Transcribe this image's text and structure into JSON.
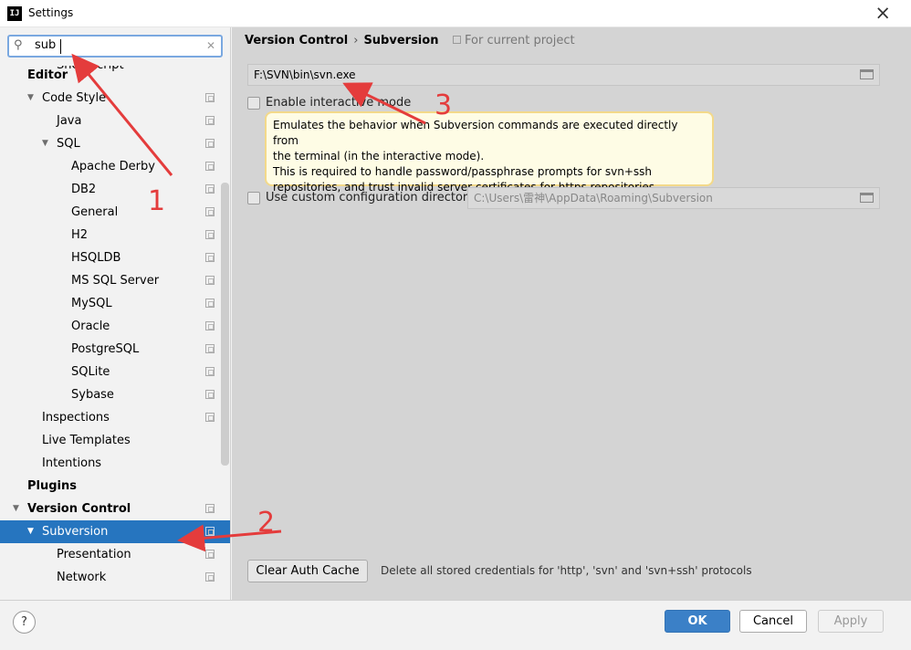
{
  "window": {
    "title": "Settings",
    "app_icon_text": "IJ",
    "close_icon": "close-icon"
  },
  "search": {
    "value": "sub",
    "search_icon": "search-icon",
    "clear_icon": "clear-icon"
  },
  "tree": {
    "items": [
      {
        "label": "Shell Script",
        "kind": "leaf",
        "copy": false
      },
      {
        "label": "Editor",
        "kind": "section",
        "copy": false
      },
      {
        "label": "Code Style",
        "kind": "expanded",
        "copy": true
      },
      {
        "label": "Java",
        "kind": "leaf",
        "copy": true
      },
      {
        "label": "SQL",
        "kind": "expanded",
        "copy": true
      },
      {
        "label": "Apache Derby",
        "kind": "leaf",
        "copy": true
      },
      {
        "label": "DB2",
        "kind": "leaf",
        "copy": true
      },
      {
        "label": "General",
        "kind": "leaf",
        "copy": true
      },
      {
        "label": "H2",
        "kind": "leaf",
        "copy": true
      },
      {
        "label": "HSQLDB",
        "kind": "leaf",
        "copy": true
      },
      {
        "label": "MS SQL Server",
        "kind": "leaf",
        "copy": true
      },
      {
        "label": "MySQL",
        "kind": "leaf",
        "copy": true
      },
      {
        "label": "Oracle",
        "kind": "leaf",
        "copy": true
      },
      {
        "label": "PostgreSQL",
        "kind": "leaf",
        "copy": true
      },
      {
        "label": "SQLite",
        "kind": "leaf",
        "copy": true
      },
      {
        "label": "Sybase",
        "kind": "leaf",
        "copy": true
      },
      {
        "label": "Inspections",
        "kind": "leaf",
        "copy": true
      },
      {
        "label": "Live Templates",
        "kind": "leaf",
        "copy": false
      },
      {
        "label": "Intentions",
        "kind": "leaf",
        "copy": false
      },
      {
        "label": "Plugins",
        "kind": "section",
        "copy": false
      },
      {
        "label": "Version Control",
        "kind": "expanded-section",
        "copy": true
      },
      {
        "label": "Subversion",
        "kind": "expanded",
        "copy": true,
        "selected": true
      },
      {
        "label": "Presentation",
        "kind": "leaf",
        "copy": true
      },
      {
        "label": "Network",
        "kind": "leaf",
        "copy": true
      }
    ]
  },
  "breadcrumb": {
    "parent": "Version Control",
    "separator": "›",
    "current": "Subversion",
    "scope": "For current project"
  },
  "svn_path": {
    "value": "F:\\SVN\\bin\\svn.exe",
    "folder_icon": "folder-icon"
  },
  "interactive_mode": {
    "label": "Enable interactive mode",
    "checked": false
  },
  "tooltip": {
    "lines": [
      "Emulates the behavior when Subversion commands are executed directly from",
      "the terminal (in the interactive mode).",
      "This is required to handle password/passphrase prompts for svn+ssh",
      "repositories, and trust invalid server certificates for https repositories."
    ]
  },
  "custom_config": {
    "label": "Use custom configuration directory:",
    "checked": false,
    "value": "C:\\Users\\雷神\\AppData\\Roaming\\Subversion"
  },
  "auth_cache": {
    "button": "Clear Auth Cache",
    "description": "Delete all stored credentials for 'http', 'svn' and 'svn+ssh' protocols"
  },
  "footer": {
    "help": "?",
    "ok": "OK",
    "cancel": "Cancel",
    "apply": "Apply"
  },
  "annotations": {
    "color": "#e43c3c",
    "labels": [
      "1",
      "2",
      "3"
    ]
  }
}
